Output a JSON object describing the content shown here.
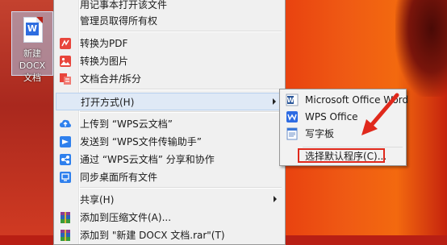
{
  "desktop_icon": {
    "label_line1": "新建 DOCX",
    "label_line2": "文档",
    "badge": "W"
  },
  "menu": {
    "items": [
      {
        "label": "用记事本打开该文件"
      },
      {
        "label": "管理员取得所有权"
      },
      {
        "label": "转换为PDF"
      },
      {
        "label": "转换为图片"
      },
      {
        "label": "文档合并/拆分"
      },
      {
        "label": "打开方式(H)"
      },
      {
        "label": "上传到 “WPS云文档”"
      },
      {
        "label": "发送到 “WPS文件传输助手”"
      },
      {
        "label": "通过 “WPS云文档” 分享和协作"
      },
      {
        "label": "同步桌面所有文件"
      },
      {
        "label": "共享(H)"
      },
      {
        "label": "添加到压缩文件(A)..."
      },
      {
        "label": "添加到 \"新建 DOCX 文档.rar\"(T)"
      }
    ]
  },
  "submenu": {
    "items": [
      {
        "label": "Microsoft Office Word"
      },
      {
        "label": "WPS Office"
      },
      {
        "label": "写字板"
      }
    ],
    "choose_default": "选择默认程序(C)..."
  }
}
